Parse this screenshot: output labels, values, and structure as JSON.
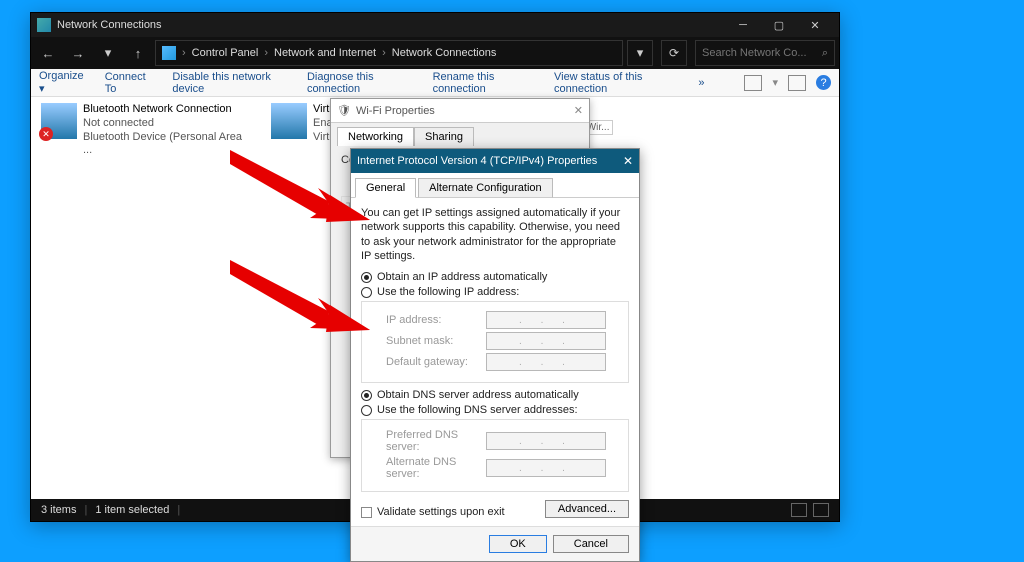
{
  "window": {
    "title": "Network Connections",
    "minimize": "─",
    "maximize": "▢",
    "close": "✕"
  },
  "nav": {
    "back": "←",
    "forward": "→",
    "up": "↑",
    "dropdown": "▾"
  },
  "breadcrumb": {
    "items": [
      "Control Panel",
      "Network and Internet",
      "Network Connections"
    ],
    "sep": "›"
  },
  "search": {
    "placeholder": "Search Network Co..."
  },
  "commandbar": {
    "organize": "Organize",
    "connect": "Connect To",
    "disable": "Disable this network device",
    "diagnose": "Diagnose this connection",
    "rename": "Rename this connection",
    "viewstatus": "View status of this connection",
    "more": "»",
    "help": "?"
  },
  "connections": [
    {
      "name": "Bluetooth Network Connection",
      "status": "Not connected",
      "device": "Bluetooth Device (Personal Area ..."
    },
    {
      "name": "VirtualB",
      "status": "Enabled",
      "device": "VirtualB"
    }
  ],
  "conn_badge": "T Wir...",
  "statusbar": {
    "count": "3 items",
    "selected": "1 item selected",
    "sep": "|"
  },
  "wifi_props": {
    "title": "Wi-Fi Properties",
    "close": "✕",
    "tabs": [
      "Networking",
      "Sharing"
    ],
    "connect_prefix": "Co"
  },
  "tcp_props": {
    "title": "Internet Protocol Version 4 (TCP/IPv4) Properties",
    "close": "✕",
    "tabs": [
      "General",
      "Alternate Configuration"
    ],
    "description": "You can get IP settings assigned automatically if your network supports this capability. Otherwise, you need to ask your network administrator for the appropriate IP settings.",
    "ip": {
      "auto": "Obtain an IP address automatically",
      "manual": "Use the following IP address:",
      "address": "IP address:",
      "subnet": "Subnet mask:",
      "gateway": "Default gateway:"
    },
    "dns": {
      "auto": "Obtain DNS server address automatically",
      "manual": "Use the following DNS server addresses:",
      "preferred": "Preferred DNS server:",
      "alternate": "Alternate DNS server:"
    },
    "validate": "Validate settings upon exit",
    "advanced": "Advanced...",
    "ok": "OK",
    "cancel": "Cancel",
    "ip_placeholder": ". . ."
  }
}
